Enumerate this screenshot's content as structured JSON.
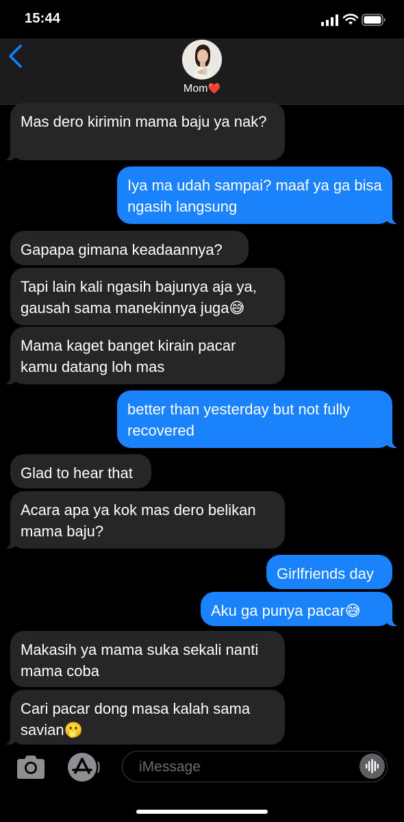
{
  "status": {
    "time": "15:44",
    "icons": [
      "signal-icon",
      "wifi-icon",
      "battery-icon"
    ]
  },
  "header": {
    "back_icon": "chevron-left-icon",
    "contact_name": "Mom",
    "contact_emoji": "❤️"
  },
  "messages": [
    {
      "dir": "in",
      "text": "Mas dero kirimin mama baju ya nak?"
    },
    {
      "dir": "out",
      "text": "Iya ma udah sampai? maaf ya ga bisa ngasih langsung"
    },
    {
      "dir": "in",
      "text": "Gapapa gimana keadaannya?"
    },
    {
      "dir": "in",
      "text": "Tapi lain kali ngasih bajunya aja ya, gausah sama manekinnya juga",
      "emoji": "😅"
    },
    {
      "dir": "in",
      "text": "Mama kaget banget kirain pacar kamu datang loh mas"
    },
    {
      "dir": "out",
      "text": "better than yesterday but not fully recovered"
    },
    {
      "dir": "in",
      "text": "Glad to hear that"
    },
    {
      "dir": "in",
      "text": "Acara apa ya kok mas dero belikan mama baju?"
    },
    {
      "dir": "out",
      "text": "Girlfriends day"
    },
    {
      "dir": "out",
      "text": "Aku ga punya pacar",
      "emoji": "😅"
    },
    {
      "dir": "in",
      "text": "Makasih ya mama suka sekali nanti mama coba"
    },
    {
      "dir": "in",
      "text": "Cari pacar dong masa kalah sama savian",
      "emoji": "🫢"
    }
  ],
  "input": {
    "placeholder": "iMessage",
    "camera_icon": "camera-icon",
    "apps_icon": "app-store-icon",
    "audio_icon": "audio-waveform-icon"
  },
  "colors": {
    "incoming_bubble": "#262628",
    "outgoing_bubble": "#1a82fb",
    "accent": "#0a84ff",
    "header_bg": "#1c1c1e"
  }
}
